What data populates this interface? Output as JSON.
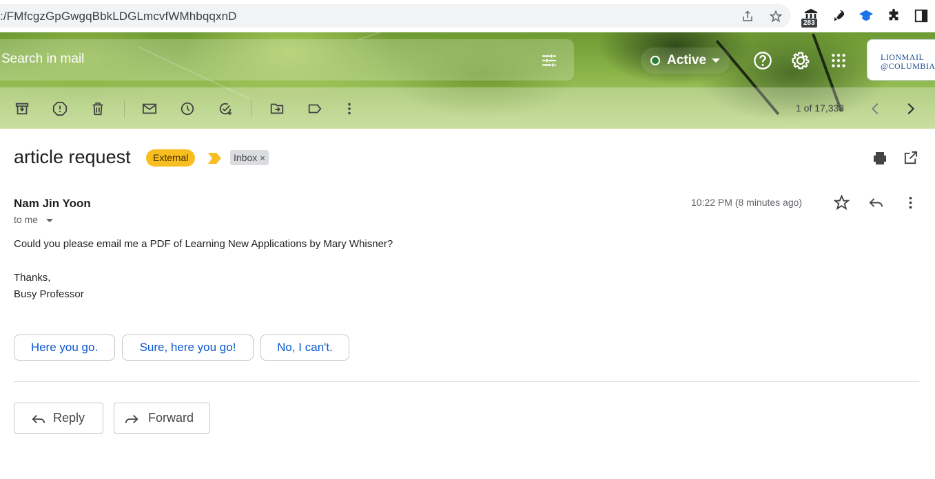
{
  "browser": {
    "url": ":/FMfcgzGpGwgqBbkLDGLmcvfWMhbqqxnD",
    "extension_badge": "283"
  },
  "header": {
    "search_placeholder": "Search in mail",
    "status_label": "Active",
    "logo_line1": "LIONMAIL",
    "logo_line2": "@COLUMBIA"
  },
  "toolbar": {
    "page_count": "1 of 17,333"
  },
  "email": {
    "subject": "article request",
    "labels": {
      "external": "External",
      "inbox": "Inbox",
      "inbox_remove": "×"
    },
    "sender": "Nam Jin Yoon",
    "to": "to me",
    "timestamp": "10:22 PM (8 minutes ago)",
    "body": [
      "Could you please email me a PDF of Learning New Applications by Mary Whisner?",
      "Thanks,",
      "Busy Professor"
    ]
  },
  "smart_replies": [
    "Here you go.",
    "Sure, here you go!",
    "No, I can't."
  ],
  "actions": {
    "reply": "Reply",
    "forward": "Forward"
  },
  "colors": {
    "external_label": "#f8bd1f",
    "link_blue": "#0b57d0",
    "importance": "#f8bd1f"
  }
}
